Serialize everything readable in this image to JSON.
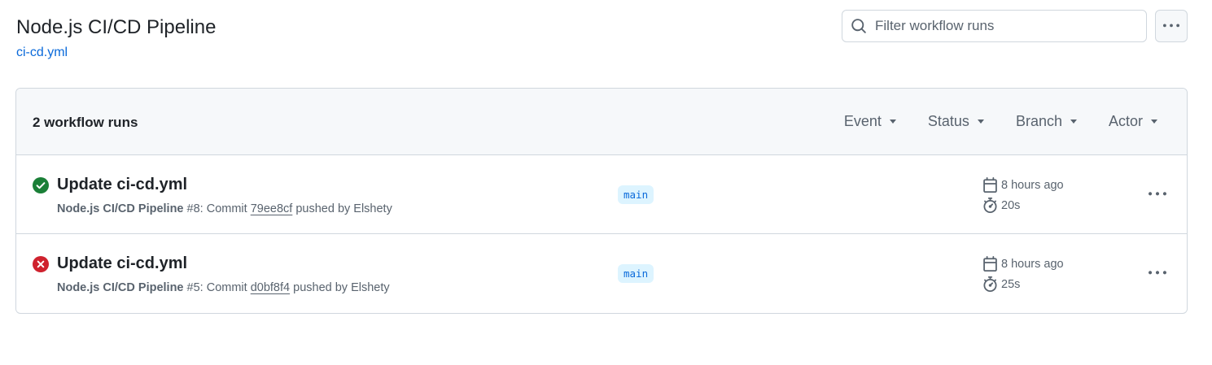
{
  "header": {
    "title": "Node.js CI/CD Pipeline",
    "workflow_file": "ci-cd.yml"
  },
  "search": {
    "placeholder": "Filter workflow runs"
  },
  "panel": {
    "runs_count": "2 workflow runs",
    "filters": [
      "Event",
      "Status",
      "Branch",
      "Actor"
    ]
  },
  "runs": [
    {
      "status": "success",
      "title": "Update ci-cd.yml",
      "workflow_name": "Node.js CI/CD Pipeline",
      "run_number": "#8",
      "commit_label": ": Commit",
      "sha": "79ee8cf",
      "pushed_by": "pushed by Elshety",
      "branch": "main",
      "time_ago": "8 hours ago",
      "duration": "20s"
    },
    {
      "status": "failure",
      "title": "Update ci-cd.yml",
      "workflow_name": "Node.js CI/CD Pipeline",
      "run_number": "#5",
      "commit_label": ": Commit",
      "sha": "d0bf8f4",
      "pushed_by": "pushed by Elshety",
      "branch": "main",
      "time_ago": "8 hours ago",
      "duration": "25s"
    }
  ],
  "icons": {
    "search": "search-icon",
    "kebab": "kebab-horizontal-icon",
    "success": "check-circle-fill-icon",
    "failure": "x-circle-fill-icon",
    "calendar": "calendar-icon",
    "stopwatch": "stopwatch-icon"
  },
  "colors": {
    "success": "#1a7f37",
    "failure": "#cf222e",
    "link": "#0969da",
    "branch_bg": "#ddf4ff",
    "muted": "#59636e"
  }
}
